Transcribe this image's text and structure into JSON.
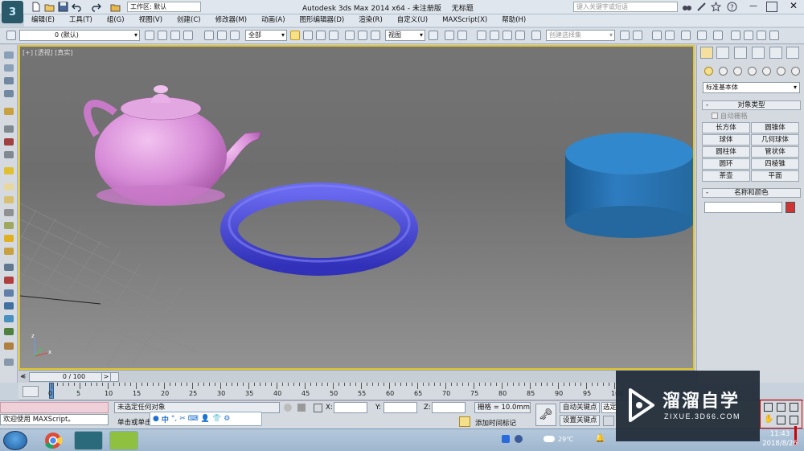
{
  "title": {
    "app": "Autodesk 3ds Max  2014 x64",
    "version": "- 未注册版",
    "doc": "无标题"
  },
  "workspace": {
    "prefix": "工作区: ",
    "value": "默认"
  },
  "search": {
    "placeholder": "键入关键字或短语"
  },
  "menu": [
    "编辑(E)",
    "工具(T)",
    "组(G)",
    "视图(V)",
    "创建(C)",
    "修改器(M)",
    "动画(A)",
    "图形编辑器(D)",
    "渲染(R)",
    "自定义(U)",
    "MAXScript(X)",
    "帮助(H)"
  ],
  "toolbar": {
    "layer": "0 (默认)",
    "filter": "全部",
    "refcoord": "视图",
    "selset": "创建选择集"
  },
  "viewport": {
    "label": "[+] [透视] [真实]"
  },
  "cmd": {
    "category": "标准基本体",
    "object_type_header": "对象类型",
    "autogrid": "自动栅格",
    "objects": [
      "长方体",
      "圆锥体",
      "球体",
      "几何球体",
      "圆柱体",
      "管状体",
      "圆环",
      "四棱锥",
      "茶壶",
      "平面"
    ],
    "name_color_header": "名称和颜色",
    "name_value": "",
    "object_color": "#cc3535",
    "collapse": "-"
  },
  "timeslider": {
    "value": "0 / 100"
  },
  "trackbar": {
    "ticks": [
      "0",
      "5",
      "10",
      "15",
      "20",
      "25",
      "30",
      "35",
      "40",
      "45",
      "50",
      "55",
      "60",
      "65",
      "70",
      "75",
      "80",
      "85",
      "90",
      "95",
      "100"
    ]
  },
  "status": {
    "welcome": "欢迎使用  MAXScript。",
    "selection": "未选定任何对象",
    "hint": "单击或单击",
    "x": "X:",
    "y": "Y:",
    "z": "Z:",
    "grid": "栅格 = 10.0mm",
    "autokey": "自动关键点",
    "setkey": "设置关键点",
    "selected": "选定",
    "addtime": "添加时间标记"
  },
  "taskbar": {
    "weather": "29℃",
    "time": "11:43",
    "date": "2018/8/26"
  },
  "watermark": {
    "title": "溜溜自学",
    "url": "ZIXUE.3D66.COM"
  },
  "colors": {
    "viewport_border": "#e3c52c",
    "teapot": "#d98ad8",
    "torus": "#4a4ad6",
    "cylinder": "#2e78b8"
  }
}
